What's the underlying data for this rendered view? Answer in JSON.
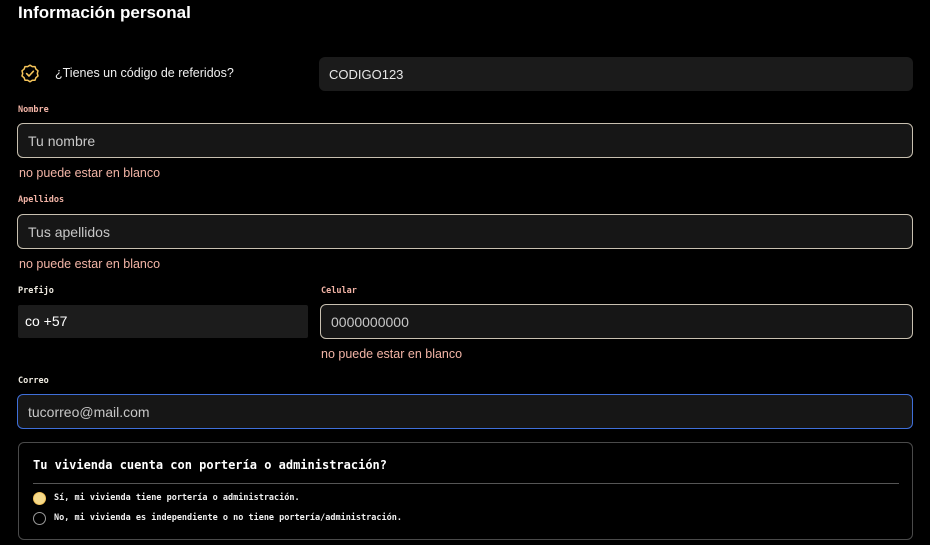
{
  "page": {
    "title": "Información personal"
  },
  "referral": {
    "icon": "check-badge-icon",
    "label": "¿Tienes un código de referidos?",
    "value": "CODIGO123"
  },
  "form": {
    "nombre": {
      "label": "Nombre",
      "placeholder": "Tu nombre",
      "value": "",
      "error": "no puede estar en blanco"
    },
    "apellidos": {
      "label": "Apellidos",
      "placeholder": "Tus apellidos",
      "value": "",
      "error": "no puede estar en blanco"
    },
    "prefijo": {
      "label": "Prefijo",
      "value": "co +57"
    },
    "celular": {
      "label": "Celular",
      "placeholder": "0000000000",
      "value": "",
      "error": "no puede estar en blanco"
    },
    "correo": {
      "label": "Correo",
      "placeholder": "tucorreo@mail.com",
      "value": ""
    }
  },
  "question": {
    "text": "Tu vivienda cuenta con portería o administración?",
    "options": [
      {
        "label": "Sí, mi vivienda tiene portería o administración.",
        "checked": true
      },
      {
        "label": "No, mi vivienda es independiente o no tiene portería/administración.",
        "checked": false
      }
    ]
  },
  "colors": {
    "background": "#000000",
    "error": "#f2b4a6",
    "focus_border": "#3f6fd9",
    "radio_checked": "#f5d98a"
  }
}
